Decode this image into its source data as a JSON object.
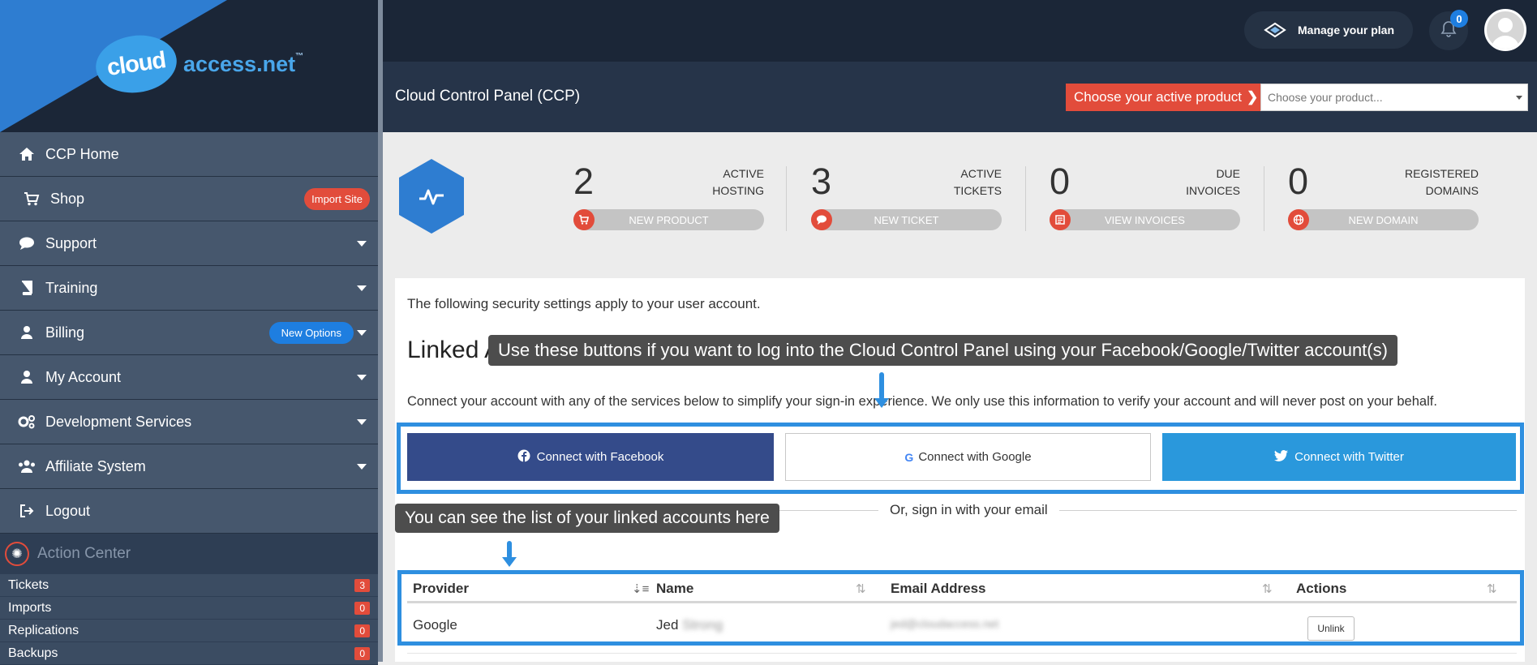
{
  "brand": {
    "logo_bubble": "cloud",
    "logo_rest": "access.net",
    "logo_tm": "™"
  },
  "sidebar": {
    "items": [
      {
        "label": "CCP Home",
        "icon": "home-icon"
      },
      {
        "label": "Shop",
        "icon": "cart-icon",
        "badge": "Import Site"
      },
      {
        "label": "Support",
        "icon": "comment-icon"
      },
      {
        "label": "Training",
        "icon": "book-icon"
      },
      {
        "label": "Billing",
        "icon": "user-icon",
        "badge": "New Options"
      },
      {
        "label": "My Account",
        "icon": "user-icon"
      },
      {
        "label": "Development Services",
        "icon": "gears-icon"
      },
      {
        "label": "Affiliate System",
        "icon": "users-icon"
      },
      {
        "label": "Logout",
        "icon": "logout-icon"
      }
    ],
    "action_center": {
      "title": "Action Center",
      "rows": [
        {
          "label": "Tickets",
          "count": "3"
        },
        {
          "label": "Imports",
          "count": "0"
        },
        {
          "label": "Replications",
          "count": "0"
        },
        {
          "label": "Backups",
          "count": "0"
        }
      ]
    }
  },
  "topbar": {
    "plan_label": "Manage your plan",
    "notifications": "0"
  },
  "subbar": {
    "title": "Cloud Control Panel (CCP)",
    "choose_label": "Choose your active product",
    "choose_placeholder": "Choose your product..."
  },
  "stats": [
    {
      "num": "2",
      "line1": "ACTIVE",
      "line2": "HOSTING",
      "action": "NEW PRODUCT"
    },
    {
      "num": "3",
      "line1": "ACTIVE",
      "line2": "TICKETS",
      "action": "NEW TICKET"
    },
    {
      "num": "0",
      "line1": "DUE",
      "line2": "INVOICES",
      "action": "VIEW INVOICES"
    },
    {
      "num": "0",
      "line1": "REGISTERED",
      "line2": "DOMAINS",
      "action": "NEW DOMAIN"
    }
  ],
  "content": {
    "intro": "The following security settings apply to your user account.",
    "heading": "Linked Accounts",
    "connect_text": "Connect your account with any of the services below to simplify your sign-in experience. We only use this information to verify your account and will never post on your behalf.",
    "fb_label": "Connect with Facebook",
    "google_label": "Connect with Google",
    "twitter_label": "Connect with Twitter",
    "or_text": "Or, sign in with your email",
    "tooltip_buttons": "Use these buttons if you want to log into the Cloud Control Panel using your Facebook/Google/Twitter account(s)",
    "tooltip_list": "You can see the list of your linked accounts here",
    "table": {
      "headers": [
        "Provider",
        "Name",
        "Email Address",
        "Actions"
      ],
      "row": {
        "provider": "Google",
        "name_visible": "Jed",
        "name_blurred": "Strong",
        "email_blurred": "jed@cloudaccess.net",
        "action": "Unlink"
      }
    }
  },
  "colors": {
    "accent_red": "#e24c3b",
    "accent_blue": "#2e8fe0",
    "facebook": "#344b8a",
    "twitter": "#2a98dc"
  }
}
